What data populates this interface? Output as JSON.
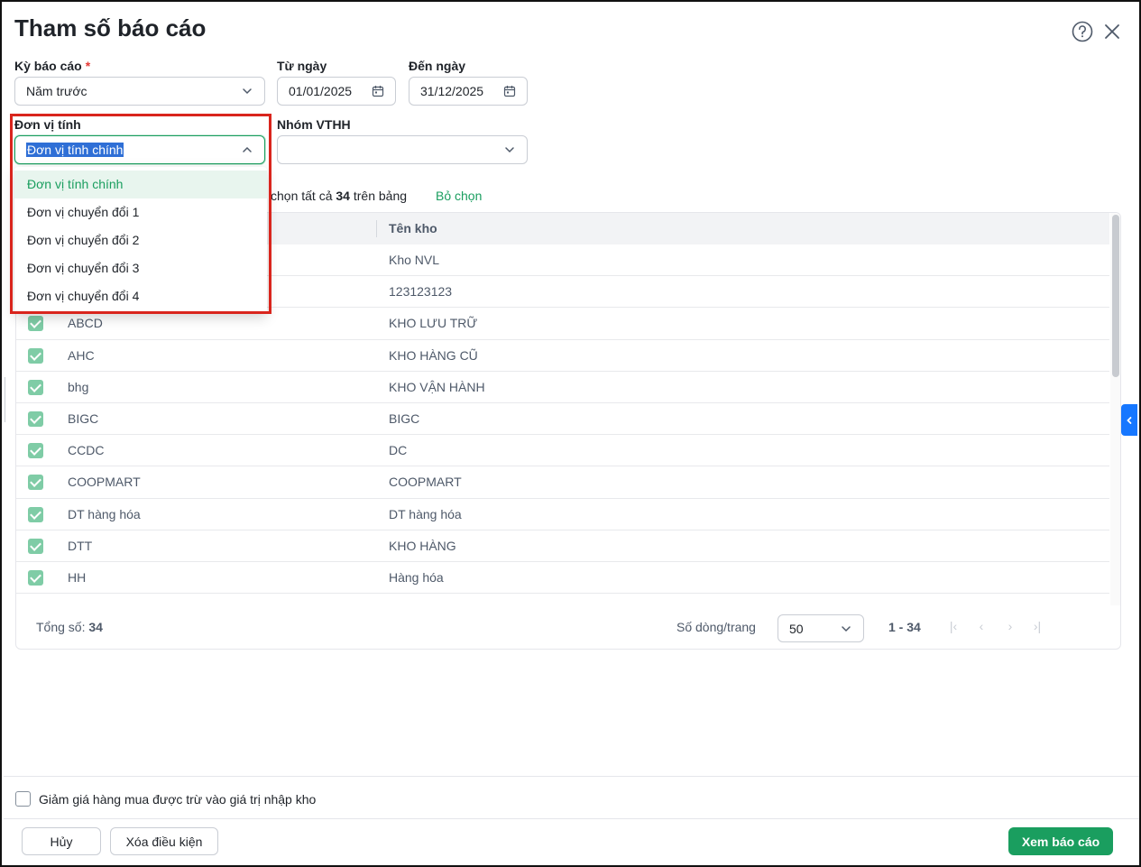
{
  "dialog": {
    "title": "Tham số báo cáo"
  },
  "form": {
    "period_label": "Kỳ báo cáo",
    "period_required": "*",
    "period_value": "Năm trước",
    "from_label": "Từ ngày",
    "from_value": "01/01/2025",
    "to_label": "Đến ngày",
    "to_value": "31/12/2025",
    "unit_label": "Đơn vị tính",
    "unit_value": "Đơn vị tính chính",
    "group_label": "Nhóm VTHH",
    "group_value": ""
  },
  "unit_dropdown": {
    "options": [
      "Đơn vị tính chính",
      "Đơn vị chuyển đổi 1",
      "Đơn vị chuyển đổi 2",
      "Đơn vị chuyển đổi 3",
      "Đơn vị chuyển đổi 4"
    ],
    "active_index": 0
  },
  "selection": {
    "prefix": "chọn tất cả",
    "count": "34",
    "suffix": "trên bảng",
    "clear_label": "Bỏ chọn"
  },
  "table": {
    "col_name": "Tên kho",
    "rows": [
      {
        "code": "",
        "name": "Kho NVL"
      },
      {
        "code": "",
        "name": "123123123"
      },
      {
        "code": "ABCD",
        "name": "KHO LƯU TRỮ"
      },
      {
        "code": "AHC",
        "name": "KHO HÀNG CŨ"
      },
      {
        "code": "bhg",
        "name": "KHO VẬN HÀNH"
      },
      {
        "code": "BIGC",
        "name": "BIGC"
      },
      {
        "code": "CCDC",
        "name": "DC"
      },
      {
        "code": "COOPMART",
        "name": "COOPMART"
      },
      {
        "code": "DT hàng hóa",
        "name": "DT hàng hóa"
      },
      {
        "code": "DTT",
        "name": "KHO HÀNG"
      },
      {
        "code": "HH",
        "name": "Hàng hóa"
      }
    ]
  },
  "footer": {
    "total_label": "Tổng số:",
    "total_value": "34",
    "rows_per_page_label": "Số dòng/trang",
    "rows_per_page_value": "50",
    "range": "1 - 34"
  },
  "options": {
    "discount_label": "Giảm giá hàng mua được trừ vào giá trị nhập kho"
  },
  "actions": {
    "cancel": "Hủy",
    "clear": "Xóa điều kiện",
    "view": "Xem báo cáo"
  },
  "colors": {
    "primary": "#1a9e5f",
    "highlight": "#d9251d",
    "side_tab": "#1677ff"
  }
}
